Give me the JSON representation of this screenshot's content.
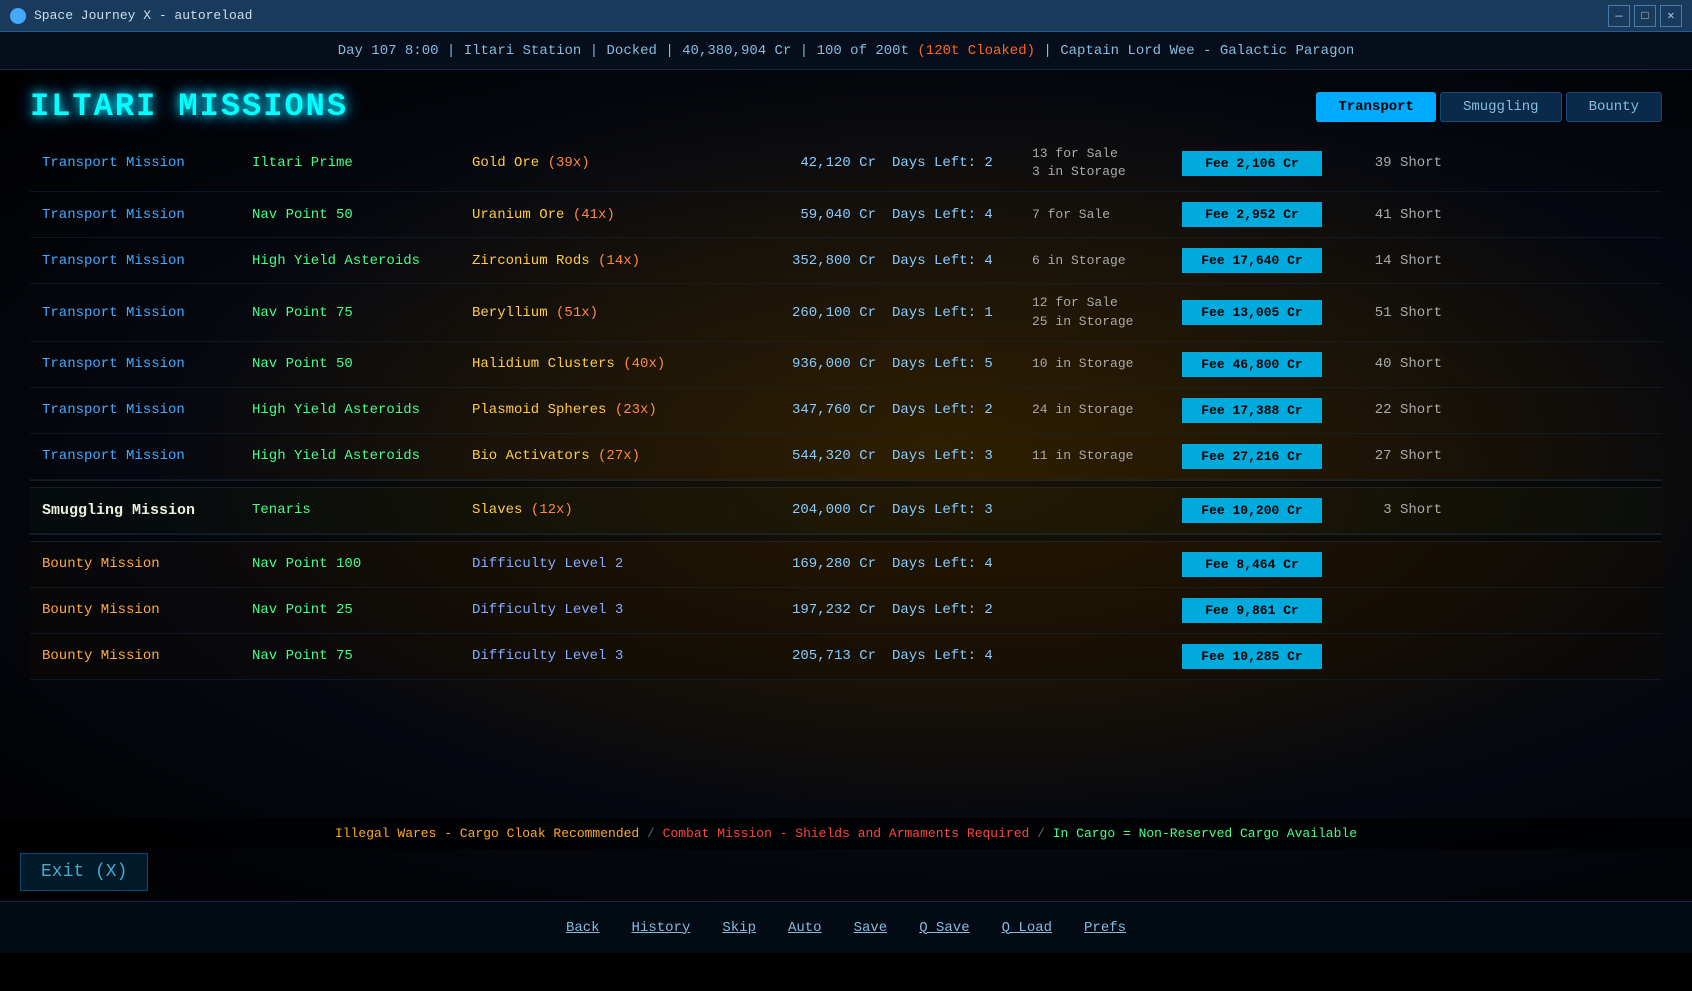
{
  "titlebar": {
    "title": "Space Journey X - autoreload",
    "min": "—",
    "max": "□",
    "close": "✕"
  },
  "status": {
    "text": "Day 107  8:00 |  Iltari Station |  Docked |  40,380,904 Cr | 100 of 200t",
    "cloaked": "(120t Cloaked)",
    "separator": "|",
    "captain": "Captain Lord Wee - Galactic Paragon"
  },
  "header": {
    "title": "ILTARI MISSIONS"
  },
  "tabs": [
    {
      "label": "Transport",
      "active": true
    },
    {
      "label": "Smuggling",
      "active": false
    },
    {
      "label": "Bounty",
      "active": false
    }
  ],
  "missions": {
    "transport": [
      {
        "type": "Transport Mission",
        "destination": "Iltari Prime",
        "cargo_name": "Gold Ore",
        "cargo_count": "39x",
        "value": "42,120 Cr",
        "days": "Days Left: 2",
        "stock_line1": "13 for Sale",
        "stock_line2": "3 in Storage",
        "fee": "Fee 2,106 Cr",
        "short": "39 Short"
      },
      {
        "type": "Transport Mission",
        "destination": "Nav Point 50",
        "cargo_name": "Uranium Ore",
        "cargo_count": "41x",
        "value": "59,040 Cr",
        "days": "Days Left: 4",
        "stock_line1": "7 for Sale",
        "stock_line2": "",
        "fee": "Fee 2,952 Cr",
        "short": "41 Short"
      },
      {
        "type": "Transport Mission",
        "destination": "High Yield Asteroids",
        "cargo_name": "Zirconium Rods",
        "cargo_count": "14x",
        "value": "352,800 Cr",
        "days": "Days Left: 4",
        "stock_line1": "6 in Storage",
        "stock_line2": "",
        "fee": "Fee 17,640 Cr",
        "short": "14 Short"
      },
      {
        "type": "Transport Mission",
        "destination": "Nav Point 75",
        "cargo_name": "Beryllium",
        "cargo_count": "51x",
        "value": "260,100 Cr",
        "days": "Days Left: 1",
        "stock_line1": "12 for Sale",
        "stock_line2": "25 in Storage",
        "fee": "Fee 13,005 Cr",
        "short": "51 Short"
      },
      {
        "type": "Transport Mission",
        "destination": "Nav Point 50",
        "cargo_name": "Halidium Clusters",
        "cargo_count": "40x",
        "value": "936,000 Cr",
        "days": "Days Left: 5",
        "stock_line1": "10 in Storage",
        "stock_line2": "",
        "fee": "Fee 46,800 Cr",
        "short": "40 Short"
      },
      {
        "type": "Transport Mission",
        "destination": "High Yield Asteroids",
        "cargo_name": "Plasmoid Spheres",
        "cargo_count": "23x",
        "value": "347,760 Cr",
        "days": "Days Left: 2",
        "stock_line1": "24 in Storage",
        "stock_line2": "",
        "fee": "Fee 17,388 Cr",
        "short": "22 Short"
      },
      {
        "type": "Transport Mission",
        "destination": "High Yield Asteroids",
        "cargo_name": "Bio Activators",
        "cargo_count": "27x",
        "value": "544,320 Cr",
        "days": "Days Left: 3",
        "stock_line1": "11 in Storage",
        "stock_line2": "",
        "fee": "Fee 27,216 Cr",
        "short": "27 Short"
      }
    ],
    "smuggling": [
      {
        "type": "Smuggling Mission",
        "destination": "Tenaris",
        "cargo_name": "Slaves",
        "cargo_count": "12x",
        "value": "204,000 Cr",
        "days": "Days Left: 3",
        "stock_line1": "",
        "stock_line2": "",
        "fee": "Fee 10,200 Cr",
        "short": "3 Short"
      }
    ],
    "bounty": [
      {
        "type": "Bounty Mission",
        "destination": "Nav Point 100",
        "difficulty": "Difficulty Level 2",
        "value": "169,280 Cr",
        "days": "Days Left: 4",
        "fee": "Fee 8,464 Cr"
      },
      {
        "type": "Bounty Mission",
        "destination": "Nav Point 25",
        "difficulty": "Difficulty Level 3",
        "value": "197,232 Cr",
        "days": "Days Left: 2",
        "fee": "Fee 9,861 Cr"
      },
      {
        "type": "Bounty Mission",
        "destination": "Nav Point 75",
        "difficulty": "Difficulty Level 3",
        "value": "205,713 Cr",
        "days": "Days Left: 4",
        "fee": "Fee 10,285 Cr"
      }
    ]
  },
  "legend": {
    "warn": "Illegal Wares - Cargo Cloak Recommended",
    "sep1": " / ",
    "combat": "Combat Mission - Shields and Armaments Required",
    "sep2": " / ",
    "cargo": "In Cargo = Non-Reserved Cargo Available"
  },
  "exit": "Exit (X)",
  "bottomnav": [
    "Back",
    "History",
    "Skip",
    "Auto",
    "Save",
    "Q Save",
    "Q Load",
    "Prefs"
  ]
}
